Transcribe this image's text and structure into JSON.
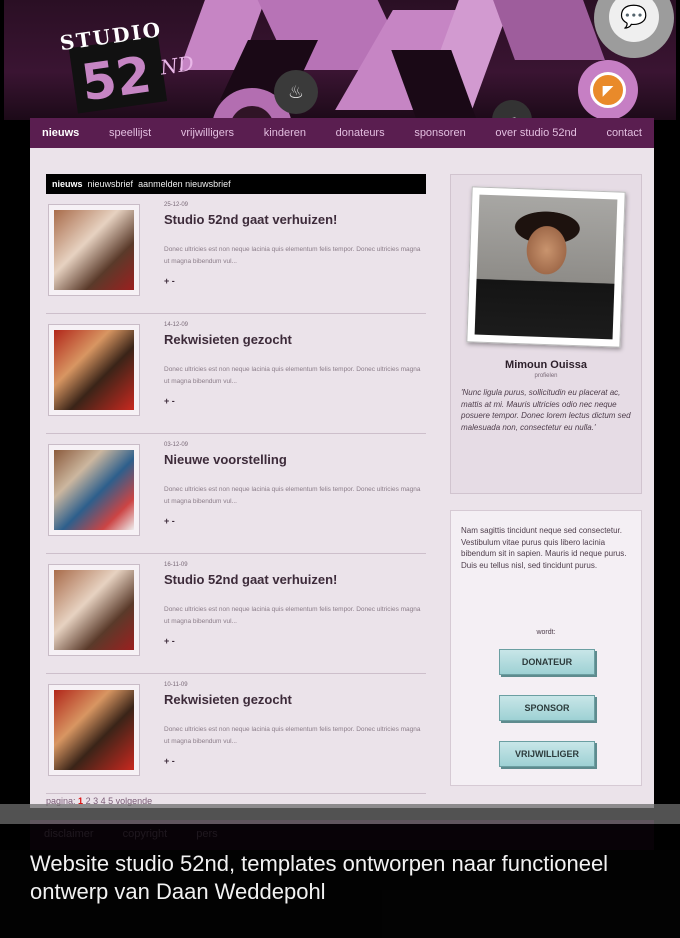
{
  "header": {
    "logo_line1": "STUDIO",
    "logo_line2": "52",
    "logo_suffix": "ND"
  },
  "nav": {
    "items": [
      {
        "label": "nieuws",
        "active": true
      },
      {
        "label": "speellijst"
      },
      {
        "label": "vrijwilligers"
      },
      {
        "label": "kinderen"
      },
      {
        "label": "donateurs"
      },
      {
        "label": "sponsoren"
      },
      {
        "label": "over studio 52nd"
      },
      {
        "label": "contact"
      }
    ]
  },
  "subnav": {
    "active": "nieuws",
    "items": [
      "nieuwsbrief",
      "aanmelden nieuwsbrief"
    ]
  },
  "articles": [
    {
      "date": "25-12-09",
      "title": "Studio 52nd gaat verhuizen!",
      "excerpt": "Donec ultricies est non neque lacinia quis elementum felis tempor. Donec ultricies magna ut magna bibendum vul...",
      "more": "+ -"
    },
    {
      "date": "14-12-09",
      "title": "Rekwisieten gezocht",
      "excerpt": "Donec ultricies est non neque lacinia quis elementum felis tempor. Donec ultricies magna ut magna bibendum vul...",
      "more": "+ -"
    },
    {
      "date": "03-12-09",
      "title": "Nieuwe voorstelling",
      "excerpt": "Donec ultricies est non neque lacinia quis elementum felis tempor. Donec ultricies magna ut magna bibendum vul...",
      "more": "+ -"
    },
    {
      "date": "16-11-09",
      "title": "Studio 52nd gaat verhuizen!",
      "excerpt": "Donec ultricies est non neque lacinia quis elementum felis tempor. Donec ultricies magna ut magna bibendum vul...",
      "more": "+ -"
    },
    {
      "date": "10-11-09",
      "title": "Rekwisieten gezocht",
      "excerpt": "Donec ultricies est non neque lacinia quis elementum felis tempor. Donec ultricies magna ut magna bibendum vul...",
      "more": "+ -"
    }
  ],
  "pagination": {
    "label": "pagina:",
    "current": "1",
    "pages": "2  3  4  5",
    "next": "volgende"
  },
  "profile": {
    "name": "Mimoun Ouissa",
    "role": "profielen",
    "quote": "'Nunc ligula purus, sollicitudin eu placerat ac, mattis at mi. Mauris ultricies odio nec neque posuere tempor. Donec lorem lectus dictum sed malesuada non, consectetur eu nulla.'"
  },
  "cta": {
    "text": "Nam sagittis tincidunt neque sed consectetur. Vestibulum vitae purus quis libero lacinia bibendum sit in sapien. Mauris id neque purus. Duis eu tellus nisl, sed tincidunt purus.",
    "wordt_label": "wordt:",
    "buttons": [
      "DONATEUR",
      "SPONSOR",
      "VRIJWILLIGER"
    ]
  },
  "footer": {
    "links": [
      "disclaimer",
      "copyright",
      "pers"
    ]
  },
  "caption": {
    "text": "Website studio 52nd, templates ontworpen naar functioneel ontwerp van Daan Weddepohl"
  }
}
